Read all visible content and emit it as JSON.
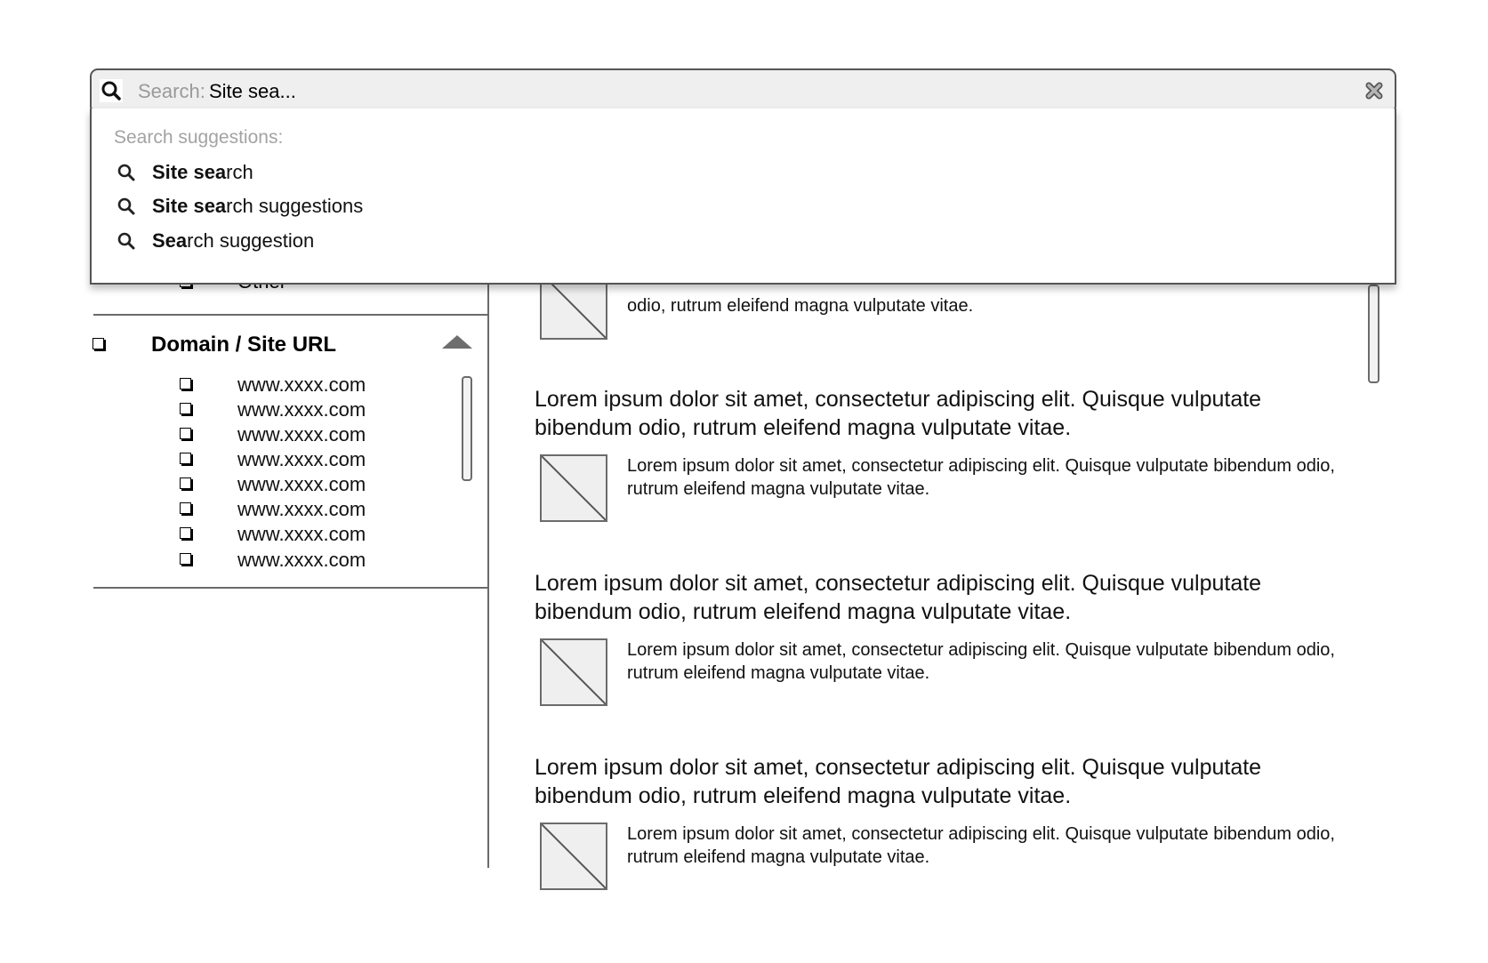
{
  "search": {
    "prefix": "Search:",
    "value": "Site sea...",
    "clear_icon": "close-x-icon",
    "search_icon": "magnifier-icon"
  },
  "suggestions": {
    "label": "Search suggestions:",
    "items": [
      {
        "bold": "Site sea",
        "rest": "rch"
      },
      {
        "bold": "Site sea",
        "rest": "rch suggestions"
      },
      {
        "bold": "Sea",
        "rest": "rch suggestion"
      }
    ]
  },
  "filters": {
    "partial_item_label": "Other",
    "domain_group": {
      "title": "Domain / Site URL",
      "expanded": true,
      "items": [
        {
          "label": "www.xxxx.com",
          "checked": false
        },
        {
          "label": "www.xxxx.com",
          "checked": false
        },
        {
          "label": "www.xxxx.com",
          "checked": false
        },
        {
          "label": "www.xxxx.com",
          "checked": false
        },
        {
          "label": "www.xxxx.com",
          "checked": false
        },
        {
          "label": "www.xxxx.com",
          "checked": false
        },
        {
          "label": "www.xxxx.com",
          "checked": false
        },
        {
          "label": "www.xxxx.com",
          "checked": false
        }
      ]
    }
  },
  "results": {
    "partial_first_snippet_line2": "odio, rutrum eleifend magna vulputate vitae.",
    "items": [
      {
        "title": "Lorem ipsum dolor sit amet, consectetur adipiscing elit. Quisque vulputate bibendum odio, rutrum eleifend magna vulputate vitae.",
        "snippet": "Lorem ipsum dolor sit amet, consectetur adipiscing elit. Quisque vulputate bibendum odio, rutrum eleifend magna vulputate vitae."
      },
      {
        "title": "Lorem ipsum dolor sit amet, consectetur adipiscing elit. Quisque vulputate bibendum odio, rutrum eleifend magna vulputate vitae.",
        "snippet": "Lorem ipsum dolor sit amet, consectetur adipiscing elit. Quisque vulputate bibendum odio, rutrum eleifend magna vulputate vitae."
      },
      {
        "title": "Lorem ipsum dolor sit amet, consectetur adipiscing elit. Quisque vulputate bibendum odio, rutrum eleifend magna vulputate vitae.",
        "snippet": "Lorem ipsum dolor sit amet, consectetur adipiscing elit. Quisque vulputate bibendum odio, rutrum eleifend magna vulputate vitae."
      }
    ]
  }
}
